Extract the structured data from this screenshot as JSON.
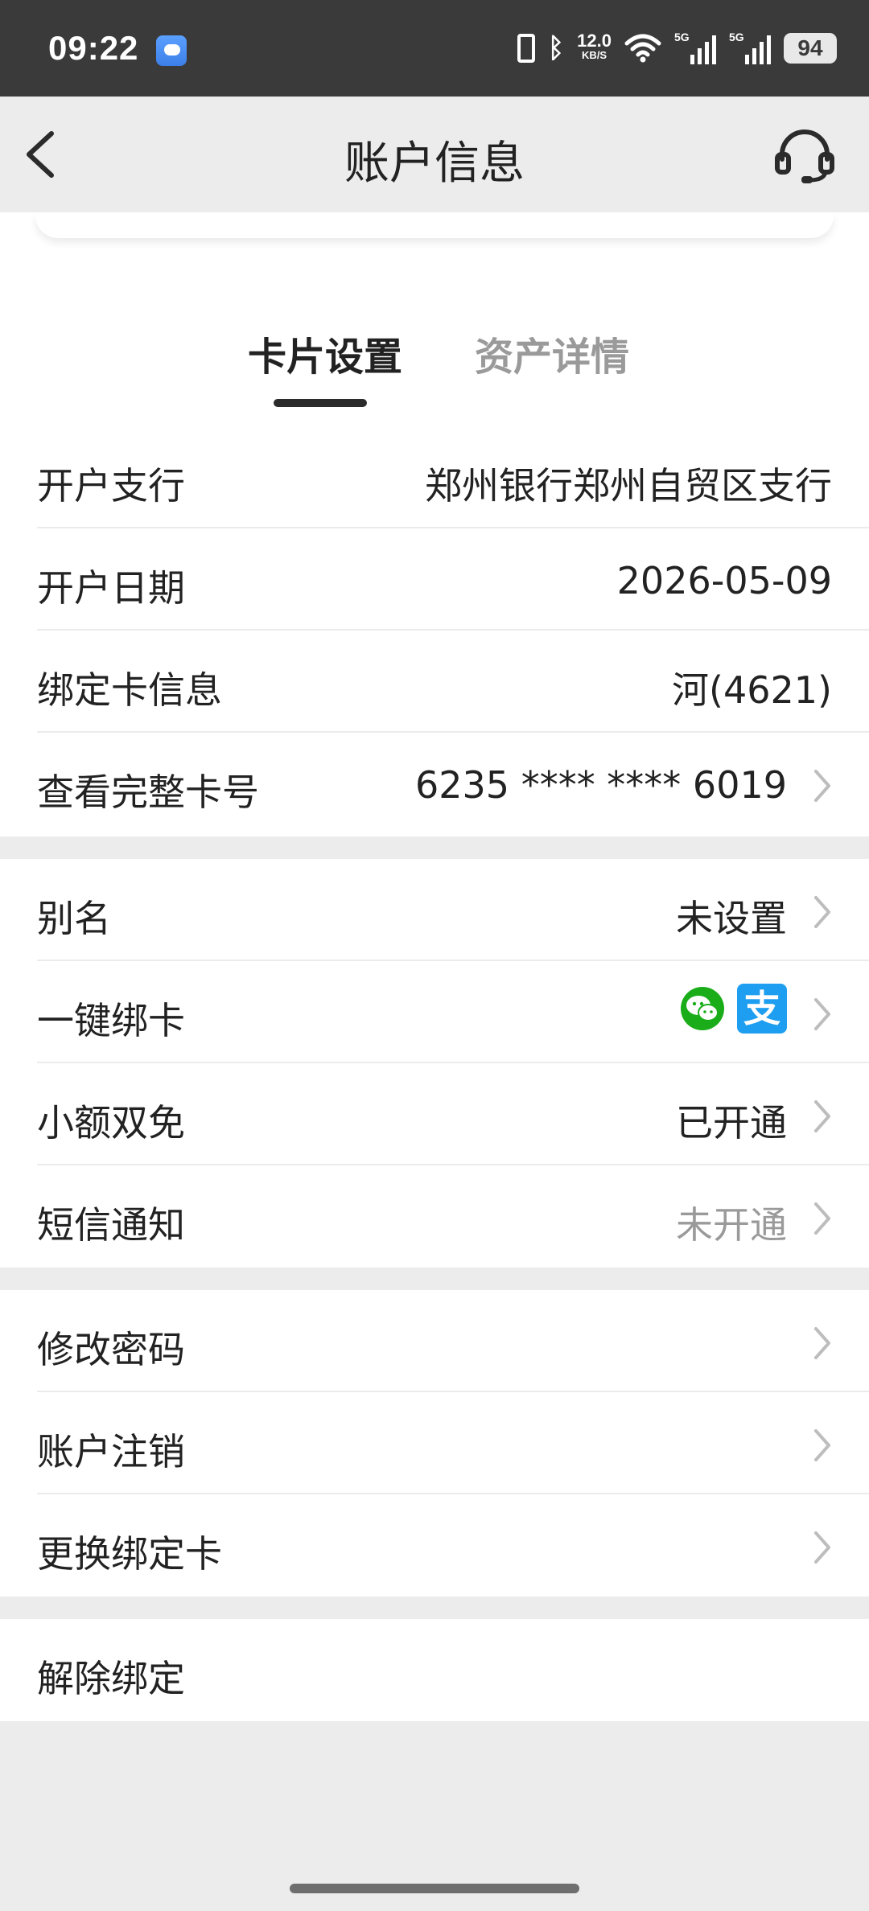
{
  "status_bar": {
    "time": "09:22",
    "net_speed": "12.0",
    "net_speed_unit": "KB/S",
    "sim1_tag": "5G",
    "sim2_tag": "5G",
    "battery": "94",
    "icons": [
      "weather-icon",
      "vibrate-icon",
      "bluetooth-icon",
      "wifi-icon",
      "signal-icon",
      "signal-icon"
    ]
  },
  "header": {
    "title": "账户信息",
    "back_icon": "chevron-left-icon",
    "service_icon": "headset-icon"
  },
  "tabs": [
    {
      "label": "卡片设置",
      "active": true
    },
    {
      "label": "资产详情",
      "active": false
    }
  ],
  "info_section": [
    {
      "label": "开户支行",
      "value": "郑州银行郑州自贸区支行"
    },
    {
      "label": "开户日期",
      "value": "2026-05-09"
    },
    {
      "label": "绑定卡信息",
      "value": "河(4621)"
    },
    {
      "label": "查看完整卡号",
      "value": "6235 **** **** 6019"
    }
  ],
  "settings_section": [
    {
      "label": "别名",
      "value": "未设置"
    },
    {
      "label": "一键绑卡",
      "value": ""
    },
    {
      "label": "小额双免",
      "value": "已开通"
    },
    {
      "label": "短信通知",
      "value": "未开通"
    }
  ],
  "bind_icons": [
    "wechat-icon",
    "alipay-icon"
  ],
  "alipay_glyph": "支",
  "account_section": [
    {
      "label": "修改密码"
    },
    {
      "label": "账户注销"
    },
    {
      "label": "更换绑定卡"
    }
  ],
  "unbind_section": {
    "label": "解除绑定"
  },
  "colors": {
    "status_bar_bg": "#3a3a3a",
    "page_bg": "#ececec",
    "text_primary": "#222222",
    "text_muted": "#9a9a9a",
    "wechat_green": "#1aad19",
    "alipay_blue": "#1e9ef0"
  }
}
